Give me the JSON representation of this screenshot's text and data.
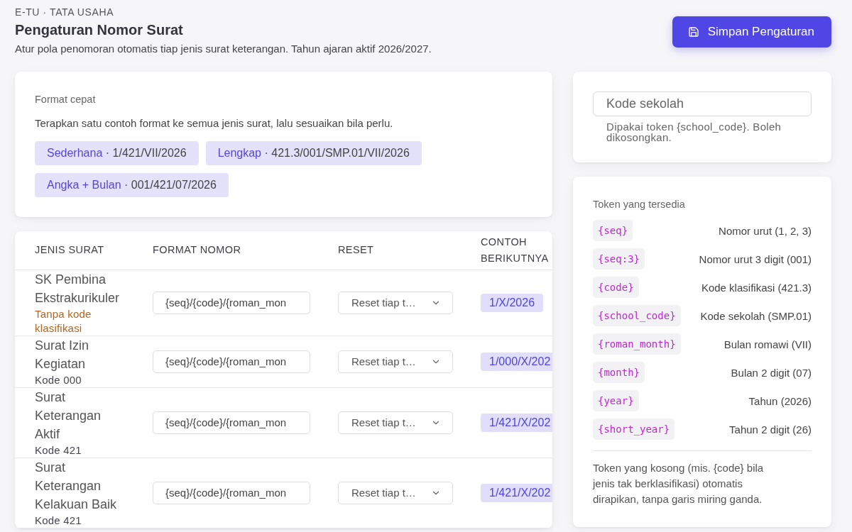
{
  "header": {
    "eyebrow": "E-TU · TATA USAHA",
    "title": "Pengaturan Nomor Surat",
    "subtitle": "Atur pola penomoran otomatis tiap jenis surat keterangan. Tahun ajaran aktif 2026/2027.",
    "save_button": "Simpan Pengaturan"
  },
  "quick_format": {
    "label": "Format cepat",
    "description": "Terapkan satu contoh format ke semua jenis surat, lalu sesuaikan bila perlu.",
    "separator": "·",
    "presets": [
      {
        "name": "Sederhana",
        "example": "1/421/VII/2026"
      },
      {
        "name": "Lengkap",
        "example": "421.3/001/SMP.01/VII/2026"
      },
      {
        "name": "Angka + Bulan",
        "example": "001/421/07/2026"
      }
    ]
  },
  "table": {
    "columns": [
      "JENIS SURAT",
      "FORMAT NOMOR",
      "RESET",
      "CONTOH BERIKUTNYA"
    ],
    "rows": [
      {
        "name": "SK Pembina Ekstrakurikuler",
        "note": {
          "kind": "warning",
          "text": "Tanpa kode klasifikasi"
        },
        "format": "{seq}/{code}/{roman_mon",
        "reset": "Reset tiap t…",
        "preview": "1/X/2026"
      },
      {
        "name": "Surat Izin Kegiatan",
        "note": {
          "kind": "code",
          "text": "Kode 000"
        },
        "format": "{seq}/{code}/{roman_mon",
        "reset": "Reset tiap t…",
        "preview": "1/000/X/202"
      },
      {
        "name": "Surat Keterangan Aktif",
        "note": {
          "kind": "code",
          "text": "Kode 421"
        },
        "format": "{seq}/{code}/{roman_mon",
        "reset": "Reset tiap t…",
        "preview": "1/421/X/202"
      },
      {
        "name": "Surat Keterangan Kelakuan Baik",
        "note": {
          "kind": "code",
          "text": "Kode 421"
        },
        "format": "{seq}/{code}/{roman_mon",
        "reset": "Reset tiap t…",
        "preview": "1/421/X/202"
      }
    ]
  },
  "school_code": {
    "placeholder": "Kode sekolah",
    "help": "Dipakai token {school_code}. Boleh dikosongkan."
  },
  "tokens": {
    "title": "Token yang tersedia",
    "items": [
      {
        "token": "{seq}",
        "description": "Nomor urut (1, 2, 3)"
      },
      {
        "token": "{seq:3}",
        "description": "Nomor urut 3 digit (001)"
      },
      {
        "token": "{code}",
        "description": "Kode klasifikasi (421.3)"
      },
      {
        "token": "{school_code}",
        "description": "Kode sekolah (SMP.01)"
      },
      {
        "token": "{roman_month}",
        "description": "Bulan romawi (VII)"
      },
      {
        "token": "{month}",
        "description": "Bulan 2 digit (07)"
      },
      {
        "token": "{year}",
        "description": "Tahun (2026)"
      },
      {
        "token": "{short_year}",
        "description": "Tahun 2 digit (26)"
      }
    ],
    "footnote": "Token yang kosong (mis. {code} bila jenis tak berklasifikasi) otomatis dirapikan, tanpa garis miring ganda."
  }
}
